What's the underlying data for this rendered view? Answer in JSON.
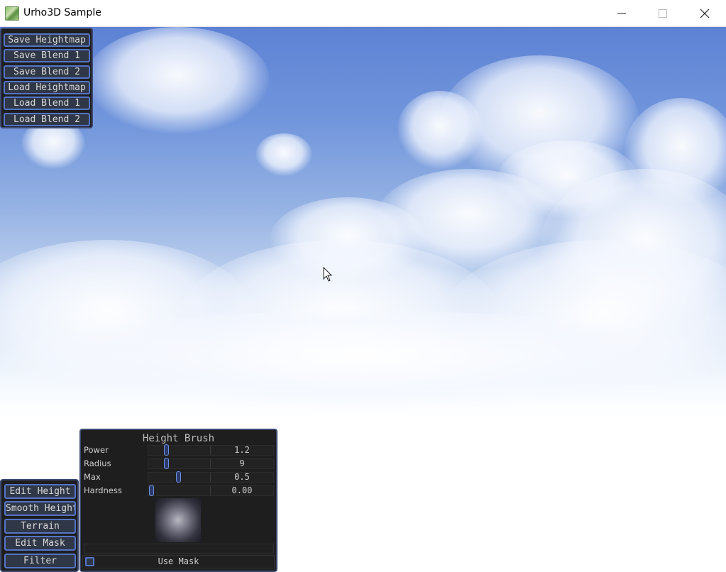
{
  "window": {
    "title": "Urho3D Sample",
    "controls": [
      "minimize-icon",
      "maximize-icon",
      "close-icon"
    ]
  },
  "file_panel": {
    "buttons": [
      {
        "label": "Save Heightmap"
      },
      {
        "label": "Save Blend 1"
      },
      {
        "label": "Save Blend 2"
      },
      {
        "label": "Load Heightmap"
      },
      {
        "label": "Load Blend 1"
      },
      {
        "label": "Load Blend 2"
      }
    ]
  },
  "mode_panel": {
    "buttons": [
      {
        "label": "Edit Height"
      },
      {
        "label": "Smooth Height"
      },
      {
        "label": "Terrain"
      },
      {
        "label": "Edit Mask"
      },
      {
        "label": "Filter"
      }
    ]
  },
  "brush_panel": {
    "title": "Height Brush",
    "rows": [
      {
        "label": "Power",
        "value": "1.2",
        "slider_fraction": 0.25
      },
      {
        "label": "Radius",
        "value": "9",
        "slider_fraction": 0.25
      },
      {
        "label": "Max",
        "value": "0.5",
        "slider_fraction": 0.45
      },
      {
        "label": "Hardness",
        "value": "0.00",
        "slider_fraction": 0.0
      }
    ],
    "use_mask": {
      "label": "Use Mask",
      "checked": false
    }
  },
  "colors": {
    "panel_bg": "#1e1e1e",
    "button_border": "#5474c8",
    "sky_top": "#5d82d4",
    "horizon": "#ffffff"
  }
}
